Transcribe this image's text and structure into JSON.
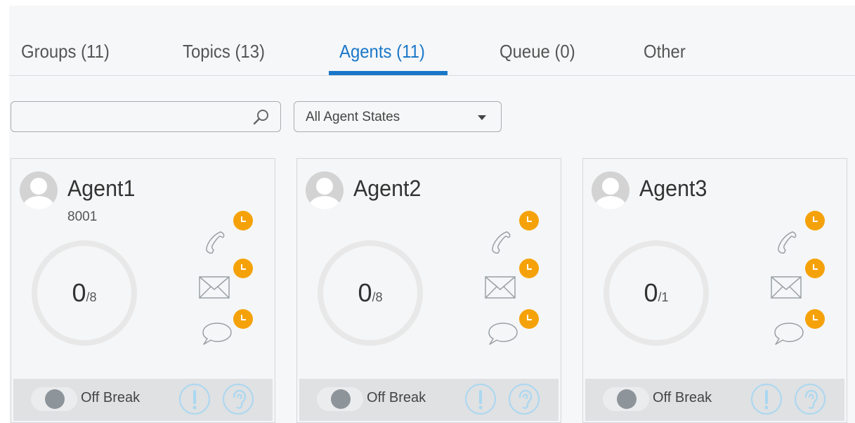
{
  "tabs": [
    {
      "label": "Groups (11)"
    },
    {
      "label": "Topics (13)"
    },
    {
      "label": "Agents (11)"
    },
    {
      "label": "Queue (0)"
    },
    {
      "label": "Other"
    }
  ],
  "active_tab": "Agents (11)",
  "search": {
    "value": "",
    "placeholder": ""
  },
  "filter": {
    "selected": "All Agent States"
  },
  "agents": [
    {
      "name": "Agent1",
      "extension": "8001",
      "count": "0",
      "capacity": "/8",
      "break_label": "Off Break"
    },
    {
      "name": "Agent2",
      "extension": "",
      "count": "0",
      "capacity": "/8",
      "break_label": "Off Break"
    },
    {
      "name": "Agent3",
      "extension": "",
      "count": "0",
      "capacity": "/1",
      "break_label": "Off Break"
    }
  ],
  "channel_icons": [
    "phone-icon",
    "email-icon",
    "chat-icon"
  ],
  "footer_icons": [
    "alert-icon",
    "listen-icon"
  ],
  "colors": {
    "accent": "#1a78c9",
    "badge": "#f5a20a",
    "action_ring": "#aad7f1"
  }
}
